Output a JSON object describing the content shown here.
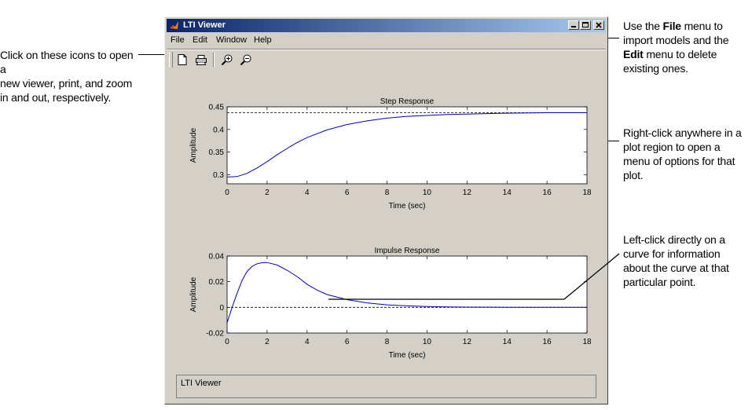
{
  "window": {
    "title": "LTI Viewer",
    "menus": [
      "File",
      "Edit",
      "Window",
      "Help"
    ],
    "toolbar": {
      "new_viewer": "new-viewer",
      "print": "print",
      "zoom_in": "zoom-in",
      "zoom_out": "zoom-out"
    },
    "status_text": "LTI Viewer"
  },
  "annotations": {
    "toolbar_note": [
      "Click on these icons to open a",
      "new viewer, print, and zoom",
      "in and out, respectively."
    ],
    "menu_note": {
      "line1_pre": "Use the ",
      "line1_bold": "File",
      "line1_post": " menu to",
      "line2": "import models and the",
      "line3_bold": "Edit",
      "line3_post": " menu to delete",
      "line4": "existing ones."
    },
    "plot_note": [
      "Right-click anywhere in a",
      "plot region to open a",
      "menu of options for that",
      "plot."
    ],
    "curve_note": [
      "Left-click directly on a",
      "curve for information",
      "about the curve at that",
      "particular point."
    ]
  },
  "chart_data": [
    {
      "type": "line",
      "title": "Step Response",
      "xlabel": "Time (sec)",
      "ylabel": "Amplitude",
      "xlim": [
        0,
        18
      ],
      "ylim": [
        0.28,
        0.45
      ],
      "xticks": [
        "0",
        "2",
        "4",
        "6",
        "8",
        "10",
        "12",
        "14",
        "16",
        "18"
      ],
      "yticks": [
        "0.3",
        "0.35",
        "0.4",
        "0.45"
      ],
      "steady_state": 0.437,
      "series": [
        {
          "color": "#0000c0",
          "x": [
            0,
            0.5,
            1,
            1.5,
            2,
            2.5,
            3,
            3.5,
            4,
            5,
            6,
            7,
            8,
            9,
            10,
            11,
            12,
            13,
            14,
            16,
            18
          ],
          "y": [
            0.295,
            0.296,
            0.303,
            0.315,
            0.329,
            0.344,
            0.358,
            0.371,
            0.382,
            0.399,
            0.411,
            0.419,
            0.425,
            0.429,
            0.431,
            0.433,
            0.434,
            0.435,
            0.436,
            0.437,
            0.437
          ]
        }
      ]
    },
    {
      "type": "line",
      "title": "Impulse Response",
      "xlabel": "Time (sec)",
      "ylabel": "Amplitude",
      "xlim": [
        0,
        18
      ],
      "ylim": [
        -0.02,
        0.04
      ],
      "xticks": [
        "0",
        "2",
        "4",
        "6",
        "8",
        "10",
        "12",
        "14",
        "16",
        "18"
      ],
      "yticks": [
        "-0.02",
        "0",
        "0.02",
        "0.04"
      ],
      "steady_state": 0,
      "series": [
        {
          "color": "#0000c0",
          "x": [
            0,
            0.25,
            0.5,
            0.75,
            1,
            1.25,
            1.5,
            1.75,
            2,
            2.5,
            3,
            3.5,
            4,
            4.5,
            5,
            6,
            7,
            8,
            9,
            10,
            11,
            12,
            14,
            16,
            18
          ],
          "y": [
            -0.012,
            0.0,
            0.011,
            0.021,
            0.028,
            0.032,
            0.034,
            0.0348,
            0.035,
            0.033,
            0.029,
            0.024,
            0.018,
            0.0135,
            0.01,
            0.006,
            0.0035,
            0.002,
            0.0012,
            0.0007,
            0.0004,
            0.0002,
            0.0001,
            0.0,
            0.0
          ]
        }
      ]
    }
  ]
}
